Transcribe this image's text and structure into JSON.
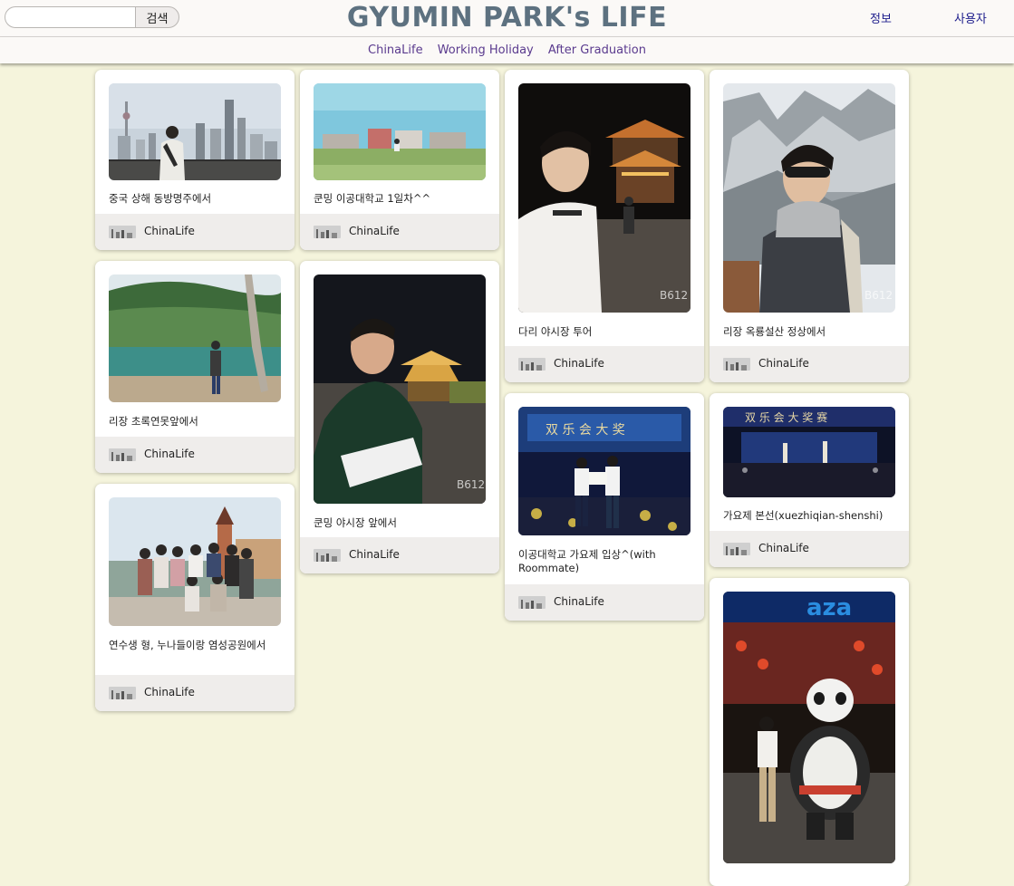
{
  "header": {
    "search": {
      "placeholder": "",
      "button_label": "검색"
    },
    "title": "GYUMIN PARK's LIFE",
    "links": {
      "info": "정보",
      "user": "사용자"
    }
  },
  "subnav": {
    "items": [
      "ChinaLife",
      "Working Holiday",
      "After Graduation"
    ]
  },
  "posts": [
    {
      "caption": "중국 상해 동방명주에서",
      "category": "ChinaLife"
    },
    {
      "caption": "리장 초록연못앞에서",
      "category": "ChinaLife"
    },
    {
      "caption": "연수생 형, 누나들이랑 염성공원에서",
      "category": "ChinaLife"
    },
    {
      "caption": "쿤밍 이공대학교 1일차^^",
      "category": "ChinaLife"
    },
    {
      "caption": "쿤밍 야시장 앞에서",
      "category": "ChinaLife"
    },
    {
      "caption": "다리 야시장 투어",
      "category": "ChinaLife"
    },
    {
      "caption": "이공대학교 가요제 입상^(with Roommate)",
      "category": "ChinaLife"
    },
    {
      "caption": "리장 옥룡설산 정상에서",
      "category": "ChinaLife"
    },
    {
      "caption": "가요제 본선(xuezhiqian-shenshi)",
      "category": "ChinaLife"
    },
    {
      "caption": "",
      "category": ""
    }
  ],
  "colors": {
    "background": "#f5f4dc",
    "title": "#5d7180",
    "subnav_link": "#5a3a8e",
    "header_link": "#1d1d8c",
    "card_footer": "#efedeb"
  }
}
